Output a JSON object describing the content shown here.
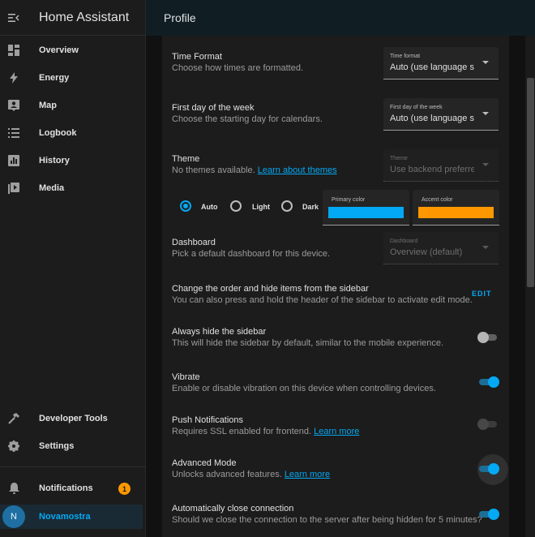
{
  "app": {
    "title": "Home Assistant",
    "page_title": "Profile"
  },
  "sidebar": {
    "items": [
      {
        "label": "Overview",
        "icon": "dashboard-icon"
      },
      {
        "label": "Energy",
        "icon": "lightning-icon"
      },
      {
        "label": "Map",
        "icon": "map-account-icon"
      },
      {
        "label": "Logbook",
        "icon": "list-icon"
      },
      {
        "label": "History",
        "icon": "chart-box-icon"
      },
      {
        "label": "Media",
        "icon": "play-box-icon"
      }
    ],
    "bottom_items": [
      {
        "label": "Developer Tools",
        "icon": "hammer-icon"
      },
      {
        "label": "Settings",
        "icon": "gear-icon"
      }
    ],
    "notifications": {
      "label": "Notifications",
      "count": "1",
      "icon": "bell-icon"
    },
    "user": {
      "name": "Novamostra",
      "initial": "N"
    }
  },
  "profile": {
    "time_format": {
      "title": "Time Format",
      "desc": "Choose how times are formatted.",
      "select_label": "Time format",
      "value": "Auto (use language se"
    },
    "first_day": {
      "title": "First day of the week",
      "desc": "Choose the starting day for calendars.",
      "select_label": "First day of the week",
      "value": "Auto (use language se"
    },
    "theme": {
      "title": "Theme",
      "desc_prefix": "No themes available. ",
      "desc_link": "Learn about themes",
      "select_label": "Theme",
      "value": "Use backend preferrec",
      "modes": [
        "Auto",
        "Light",
        "Dark"
      ],
      "selected_mode": "Auto",
      "primary_label": "Primary color",
      "primary_color": "#03a9f4",
      "accent_label": "Accent color",
      "accent_color": "#ff9800"
    },
    "dashboard": {
      "title": "Dashboard",
      "desc": "Pick a default dashboard for this device.",
      "select_label": "Dashboard",
      "value": "Overview (default)"
    },
    "sidebar_order": {
      "title": "Change the order and hide items from the sidebar",
      "desc": "You can also press and hold the header of the sidebar to activate edit mode.",
      "button": "EDIT"
    },
    "hide_sidebar": {
      "title": "Always hide the sidebar",
      "desc": "This will hide the sidebar by default, similar to the mobile experience.",
      "enabled": false
    },
    "vibrate": {
      "title": "Vibrate",
      "desc": "Enable or disable vibration on this device when controlling devices.",
      "enabled": true
    },
    "push": {
      "title": "Push Notifications",
      "desc_prefix": "Requires SSL enabled for frontend. ",
      "desc_link": "Learn more",
      "enabled": false
    },
    "advanced": {
      "title": "Advanced Mode",
      "desc_prefix": "Unlocks advanced features. ",
      "desc_link": "Learn more",
      "enabled": true
    },
    "auto_close": {
      "title": "Automatically close connection",
      "desc": "Should we close the connection to the server after being hidden for 5 minutes?",
      "enabled": true
    }
  }
}
